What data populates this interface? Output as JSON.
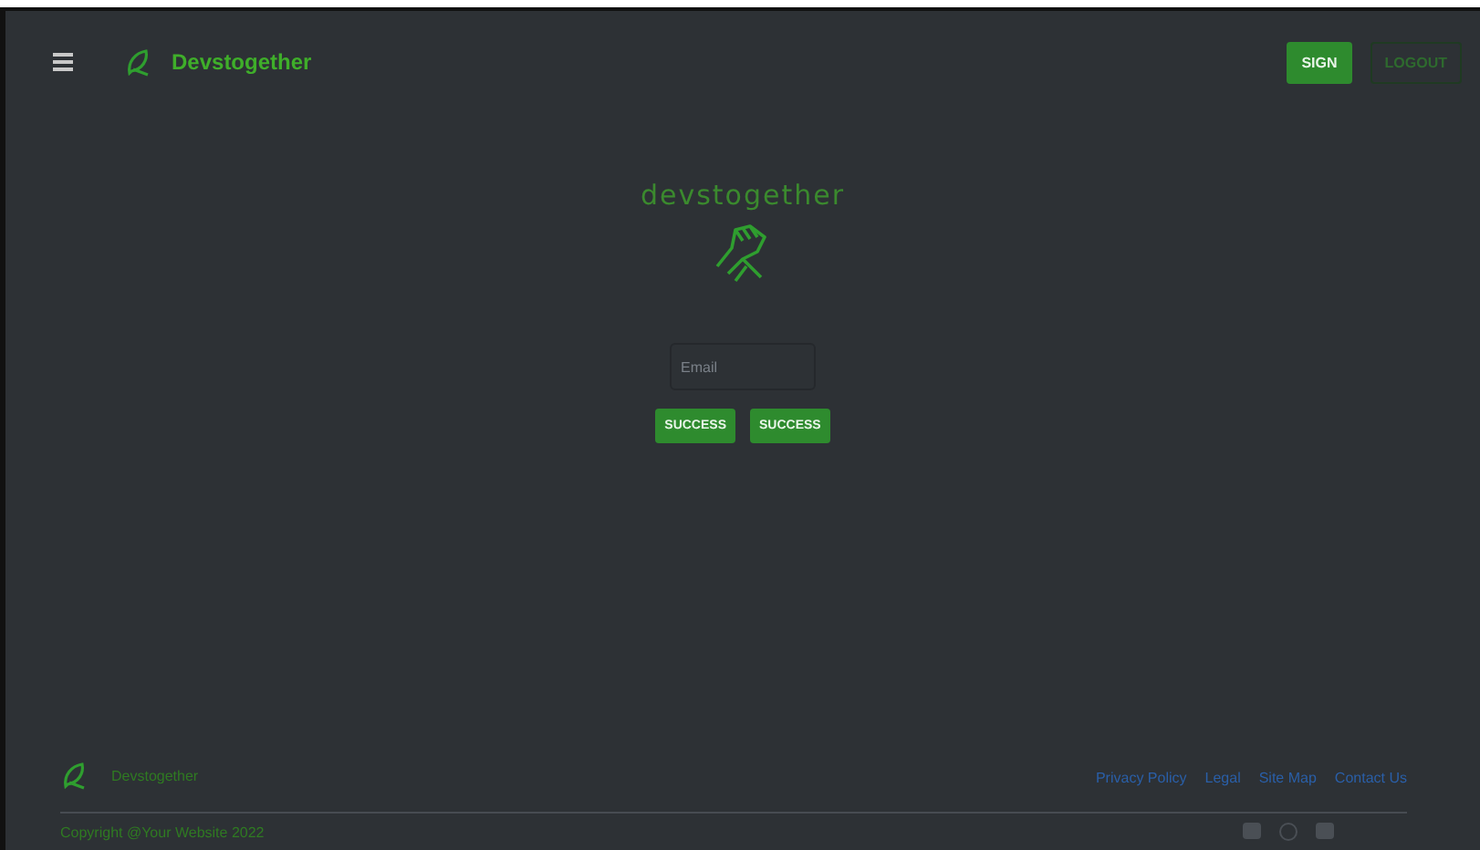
{
  "navbar": {
    "brand": "Devstogether",
    "buttons": [
      {
        "label": "SIGN",
        "kind": "filled"
      },
      {
        "label": "LOGOUT",
        "kind": "outline"
      }
    ]
  },
  "hero": {
    "title": "devstogether",
    "email": {
      "placeholder": "Email"
    },
    "buttons": [
      "SUCCESS",
      "SUCCESS"
    ]
  },
  "footer": {
    "brand": "Devstogether",
    "links": [
      "Privacy Policy",
      "Legal",
      "Site Map",
      "Contact Us"
    ],
    "copyright": "Copyright @Your Website 2022"
  }
}
